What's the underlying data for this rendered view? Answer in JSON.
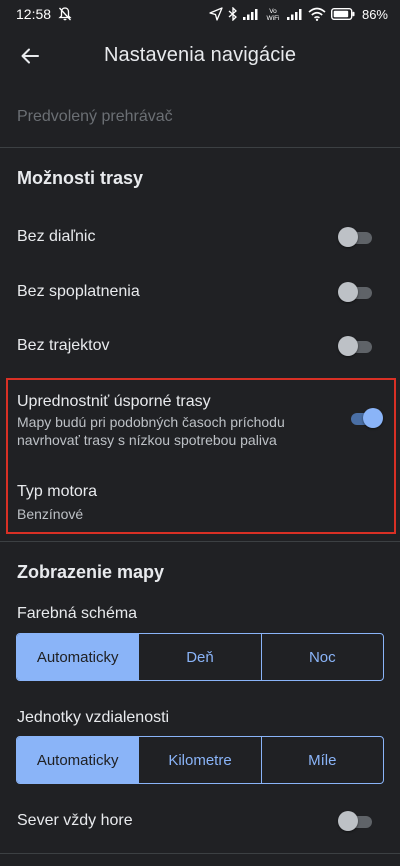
{
  "status_bar": {
    "time": "12:58",
    "network_label": "Vo WiFi",
    "battery": "86%"
  },
  "app_bar": {
    "title": "Nastavenia navigácie"
  },
  "faded_row": "Predvolený prehrávač",
  "route_options": {
    "title": "Možnosti trasy",
    "items": [
      {
        "label": "Bez diaľnic",
        "on": false
      },
      {
        "label": "Bez spoplatnenia",
        "on": false
      },
      {
        "label": "Bez trajektov",
        "on": false
      }
    ],
    "eco": {
      "label": "Uprednostniť úsporné trasy",
      "sub_line1": "Mapy budú pri podobných časoch príchodu",
      "sub_line2": "navrhovať trasy s nízkou spotrebou paliva",
      "on": true
    },
    "engine": {
      "label": "Typ motora",
      "value": "Benzínové"
    }
  },
  "map_display": {
    "title": "Zobrazenie mapy",
    "color_scheme": {
      "label": "Farebná schéma",
      "options": [
        "Automaticky",
        "Deň",
        "Noc"
      ],
      "selected": "Automaticky"
    },
    "distance_units": {
      "label": "Jednotky vzdialenosti",
      "options": [
        "Automaticky",
        "Kilometre",
        "Míle"
      ],
      "selected": "Automaticky"
    },
    "north_up": {
      "label": "Sever vždy hore",
      "on": false
    }
  },
  "colors": {
    "background": "#202124",
    "accent": "#8ab4f8",
    "highlight_border": "#d93025"
  }
}
